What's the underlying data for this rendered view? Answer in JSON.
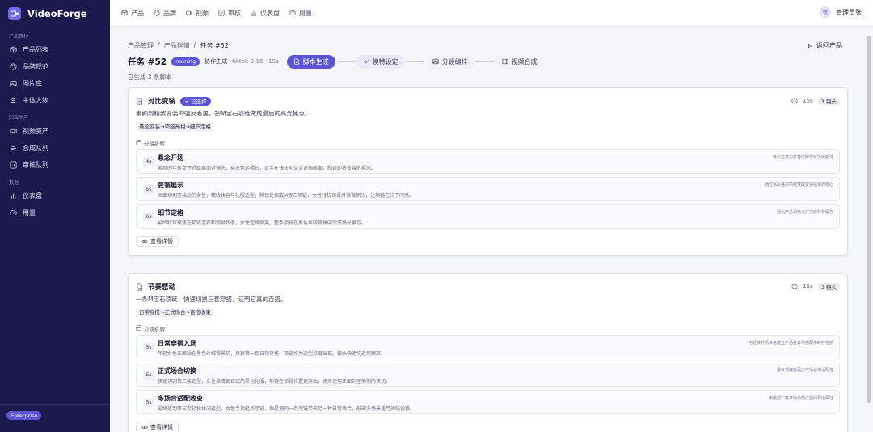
{
  "app": {
    "name": "VideoForge",
    "badge": "Enterprise"
  },
  "sidebar": {
    "sections": [
      {
        "title": "产品素材",
        "items": [
          {
            "label": "产品列表",
            "icon": "box-icon"
          },
          {
            "label": "品牌规范",
            "icon": "palette-icon"
          },
          {
            "label": "图片库",
            "icon": "image-icon"
          },
          {
            "label": "主体人物",
            "icon": "user-icon"
          }
        ]
      },
      {
        "title": "内容生产",
        "items": [
          {
            "label": "视频资产",
            "icon": "video-icon"
          },
          {
            "label": "合成队列",
            "icon": "queue-icon"
          },
          {
            "label": "审核队列",
            "icon": "check-square-icon"
          }
        ]
      },
      {
        "title": "数据",
        "items": [
          {
            "label": "仪表盘",
            "icon": "bar-chart-icon"
          },
          {
            "label": "用量",
            "icon": "gauge-icon"
          }
        ]
      }
    ]
  },
  "topnav": {
    "items": [
      {
        "label": "产品",
        "icon": "box-icon"
      },
      {
        "label": "品牌",
        "icon": "palette-icon"
      },
      {
        "label": "视频",
        "icon": "video-icon"
      },
      {
        "label": "审核",
        "icon": "check-square-icon"
      },
      {
        "label": "仪表盘",
        "icon": "bar-chart-icon"
      },
      {
        "label": "用量",
        "icon": "gauge-icon"
      }
    ],
    "user": {
      "avatar": "管",
      "name": "管理员张"
    }
  },
  "breadcrumb": [
    "产品管理",
    "/",
    "产品详情",
    "/",
    "任务 #52"
  ],
  "back_label": "返回产品",
  "task": {
    "title": "任务 #52",
    "status": "running",
    "mode": "协作生成",
    "meta": "tiktok-9-16 · 15s",
    "steps": [
      {
        "label": "脚本生成",
        "state": "active"
      },
      {
        "label": "模特设定",
        "state": "next"
      },
      {
        "label": "分镜编排",
        "state": "todo"
      },
      {
        "label": "视频合成",
        "state": "todo"
      }
    ],
    "generated": "已生成 3 条脚本"
  },
  "labels": {
    "breakdown": "分镜拆解",
    "view_detail": "查看详情",
    "selected": "已选择"
  },
  "scripts": [
    {
      "title": "对比变装",
      "selected": true,
      "duration": "15s",
      "shots_count": "3 镜头",
      "desc": "素颜到精致变装的强反差里，把M宝石项链做成最后的高光焦点。",
      "flow": "悬念变装→项链亮相→细节定格",
      "shots": [
        {
          "dur": "4s",
          "title": "悬念开场",
          "desc": "素颜的年轻女性近距离面对镜头，穿深色连帽衫，双手在镜头前交叉遮挡画面，制造即将变装的悬念。",
          "note": "吸引注意力并营造即将转换的期待"
        },
        {
          "dur": "5s",
          "title": "变装展示",
          "desc": "画面切到变装后的女性，精致妆容与礼服造型，脖颈处佩戴M宝石项链，女性轻抚颈骨并微微侧头，让项链在光下闪亮。",
          "note": "通过强反差把项链变成变装结果的核心"
        },
        {
          "dur": "6s",
          "title": "细节定格",
          "desc": "最终特写聚焦在项链宝石和锁骨线条，女性定格微笑，整条项链在黑色丝绒背景中完成高光展示。",
          "note": "强化产品记忆点并完成种草留存"
        }
      ]
    },
    {
      "title": "节奏感动",
      "selected": false,
      "duration": "15s",
      "shots_count": "3 镜头",
      "desc": "一条M宝石项链，快速切换三套穿搭，证明它真的百搭。",
      "flow": "日常穿搭→正式场合→百搭收束",
      "shots": [
        {
          "dur": "5s",
          "title": "日常穿搭入场",
          "desc": "年轻女性正面站在黑色丝绒背景前，身穿第一套日常穿搭，项链作为造型点缀出现，镜头快速切近到颈部。",
          "note": "用轻快开场快速建立产品在日常搭配中的存在感"
        },
        {
          "dur": "5s",
          "title": "正式场合切换",
          "desc": "快速切到第二套造型，女性换成更正式的黑色礼服，项链在锁骨位置更突出，镜头使用正面到左前侧的快切。",
          "note": "展示项链在更正式场合的适配性"
        },
        {
          "dur": "5s",
          "title": "多场合适配收束",
          "desc": "最终落到第三套轻松休闲造型，女性手指轻点项链，像是把同一条项链带去另一种日常场合，形成多场景适用的结论感。",
          "note": "用最后一套穿搭总结产品的百搭属性"
        }
      ]
    }
  ],
  "colors": {
    "sidebar_bg": "#1c1a4d",
    "accent": "#5b55d6",
    "accent_soft": "#ebeaf9"
  }
}
